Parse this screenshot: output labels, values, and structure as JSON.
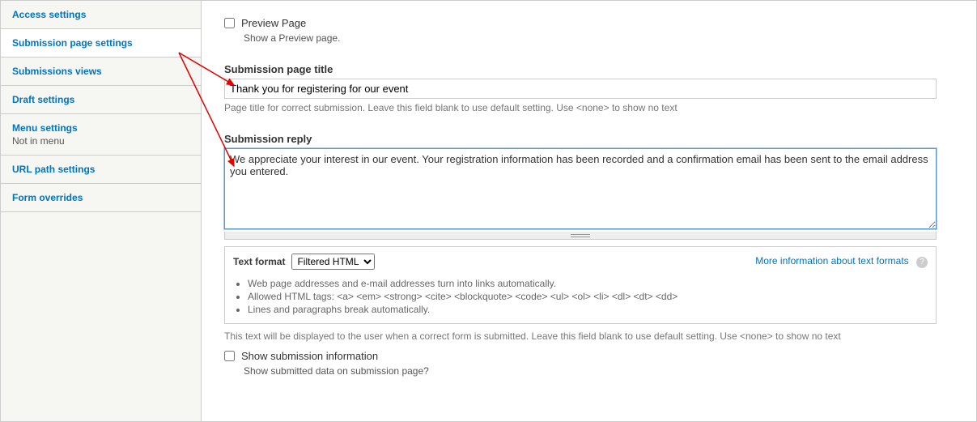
{
  "sidebar": {
    "items": [
      {
        "label": "Access settings"
      },
      {
        "label": "Submission page settings"
      },
      {
        "label": "Submissions views"
      },
      {
        "label": "Draft settings"
      },
      {
        "label": "Menu settings",
        "sub": "Not in menu"
      },
      {
        "label": "URL path settings"
      },
      {
        "label": "Form overrides"
      }
    ]
  },
  "preview": {
    "label": "Preview Page",
    "desc": "Show a Preview page."
  },
  "title_section": {
    "heading": "Submission page title",
    "value": "Thank you for registering for our event",
    "help": "Page title for correct submission. Leave this field blank to use default setting. Use <none> to show no text"
  },
  "reply_section": {
    "heading": "Submission reply",
    "value": "We appreciate your interest in our event. Your registration information has been recorded and a confirmation email has been sent to the email address you entered."
  },
  "format": {
    "label": "Text format",
    "selected": "Filtered HTML",
    "info_link": "More information about text formats",
    "tips": [
      "Web page addresses and e-mail addresses turn into links automatically.",
      "Allowed HTML tags: <a> <em> <strong> <cite> <blockquote> <code> <ul> <ol> <li> <dl> <dt> <dd>",
      "Lines and paragraphs break automatically."
    ]
  },
  "reply_help": "This text will be displayed to the user when a correct form is submitted. Leave this field blank to use default setting. Use <none> to show no text",
  "show_info": {
    "label": "Show submission information",
    "desc": "Show submitted data on submission page?"
  }
}
